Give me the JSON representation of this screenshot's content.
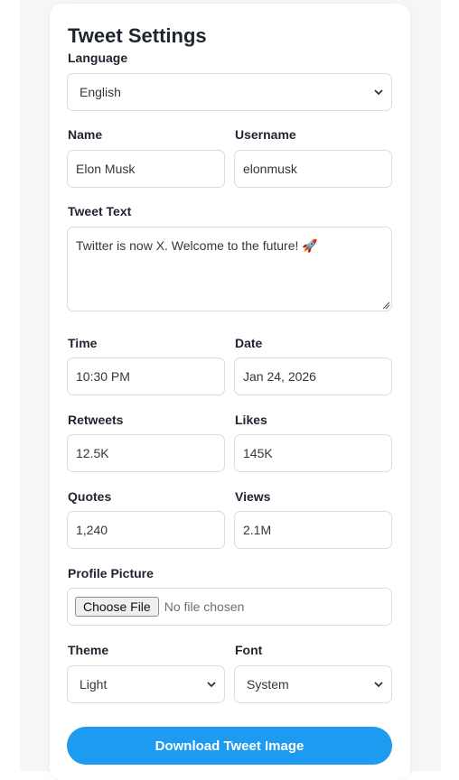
{
  "settings": {
    "title": "Tweet Settings",
    "language": {
      "label": "Language",
      "value": "English"
    },
    "name": {
      "label": "Name",
      "value": "Elon Musk"
    },
    "username": {
      "label": "Username",
      "value": "elonmusk"
    },
    "tweet_text": {
      "label": "Tweet Text",
      "value": "Twitter is now X. Welcome to the future! 🚀"
    },
    "time": {
      "label": "Time",
      "value": "10:30 PM"
    },
    "date": {
      "label": "Date",
      "value": "Jan 24, 2026"
    },
    "retweets": {
      "label": "Retweets",
      "value": "12.5K"
    },
    "likes": {
      "label": "Likes",
      "value": "145K"
    },
    "quotes": {
      "label": "Quotes",
      "value": "1,240"
    },
    "views": {
      "label": "Views",
      "value": "2.1M"
    },
    "profile_picture": {
      "label": "Profile Picture",
      "button": "Choose File",
      "status": "No file chosen"
    },
    "theme": {
      "label": "Theme",
      "value": "Light"
    },
    "font": {
      "label": "Font",
      "value": "System"
    },
    "download_label": "Download Tweet Image"
  },
  "colors": {
    "accent": "#1d9bf0",
    "label_text": "#1e2430",
    "border": "#d9dde2"
  }
}
